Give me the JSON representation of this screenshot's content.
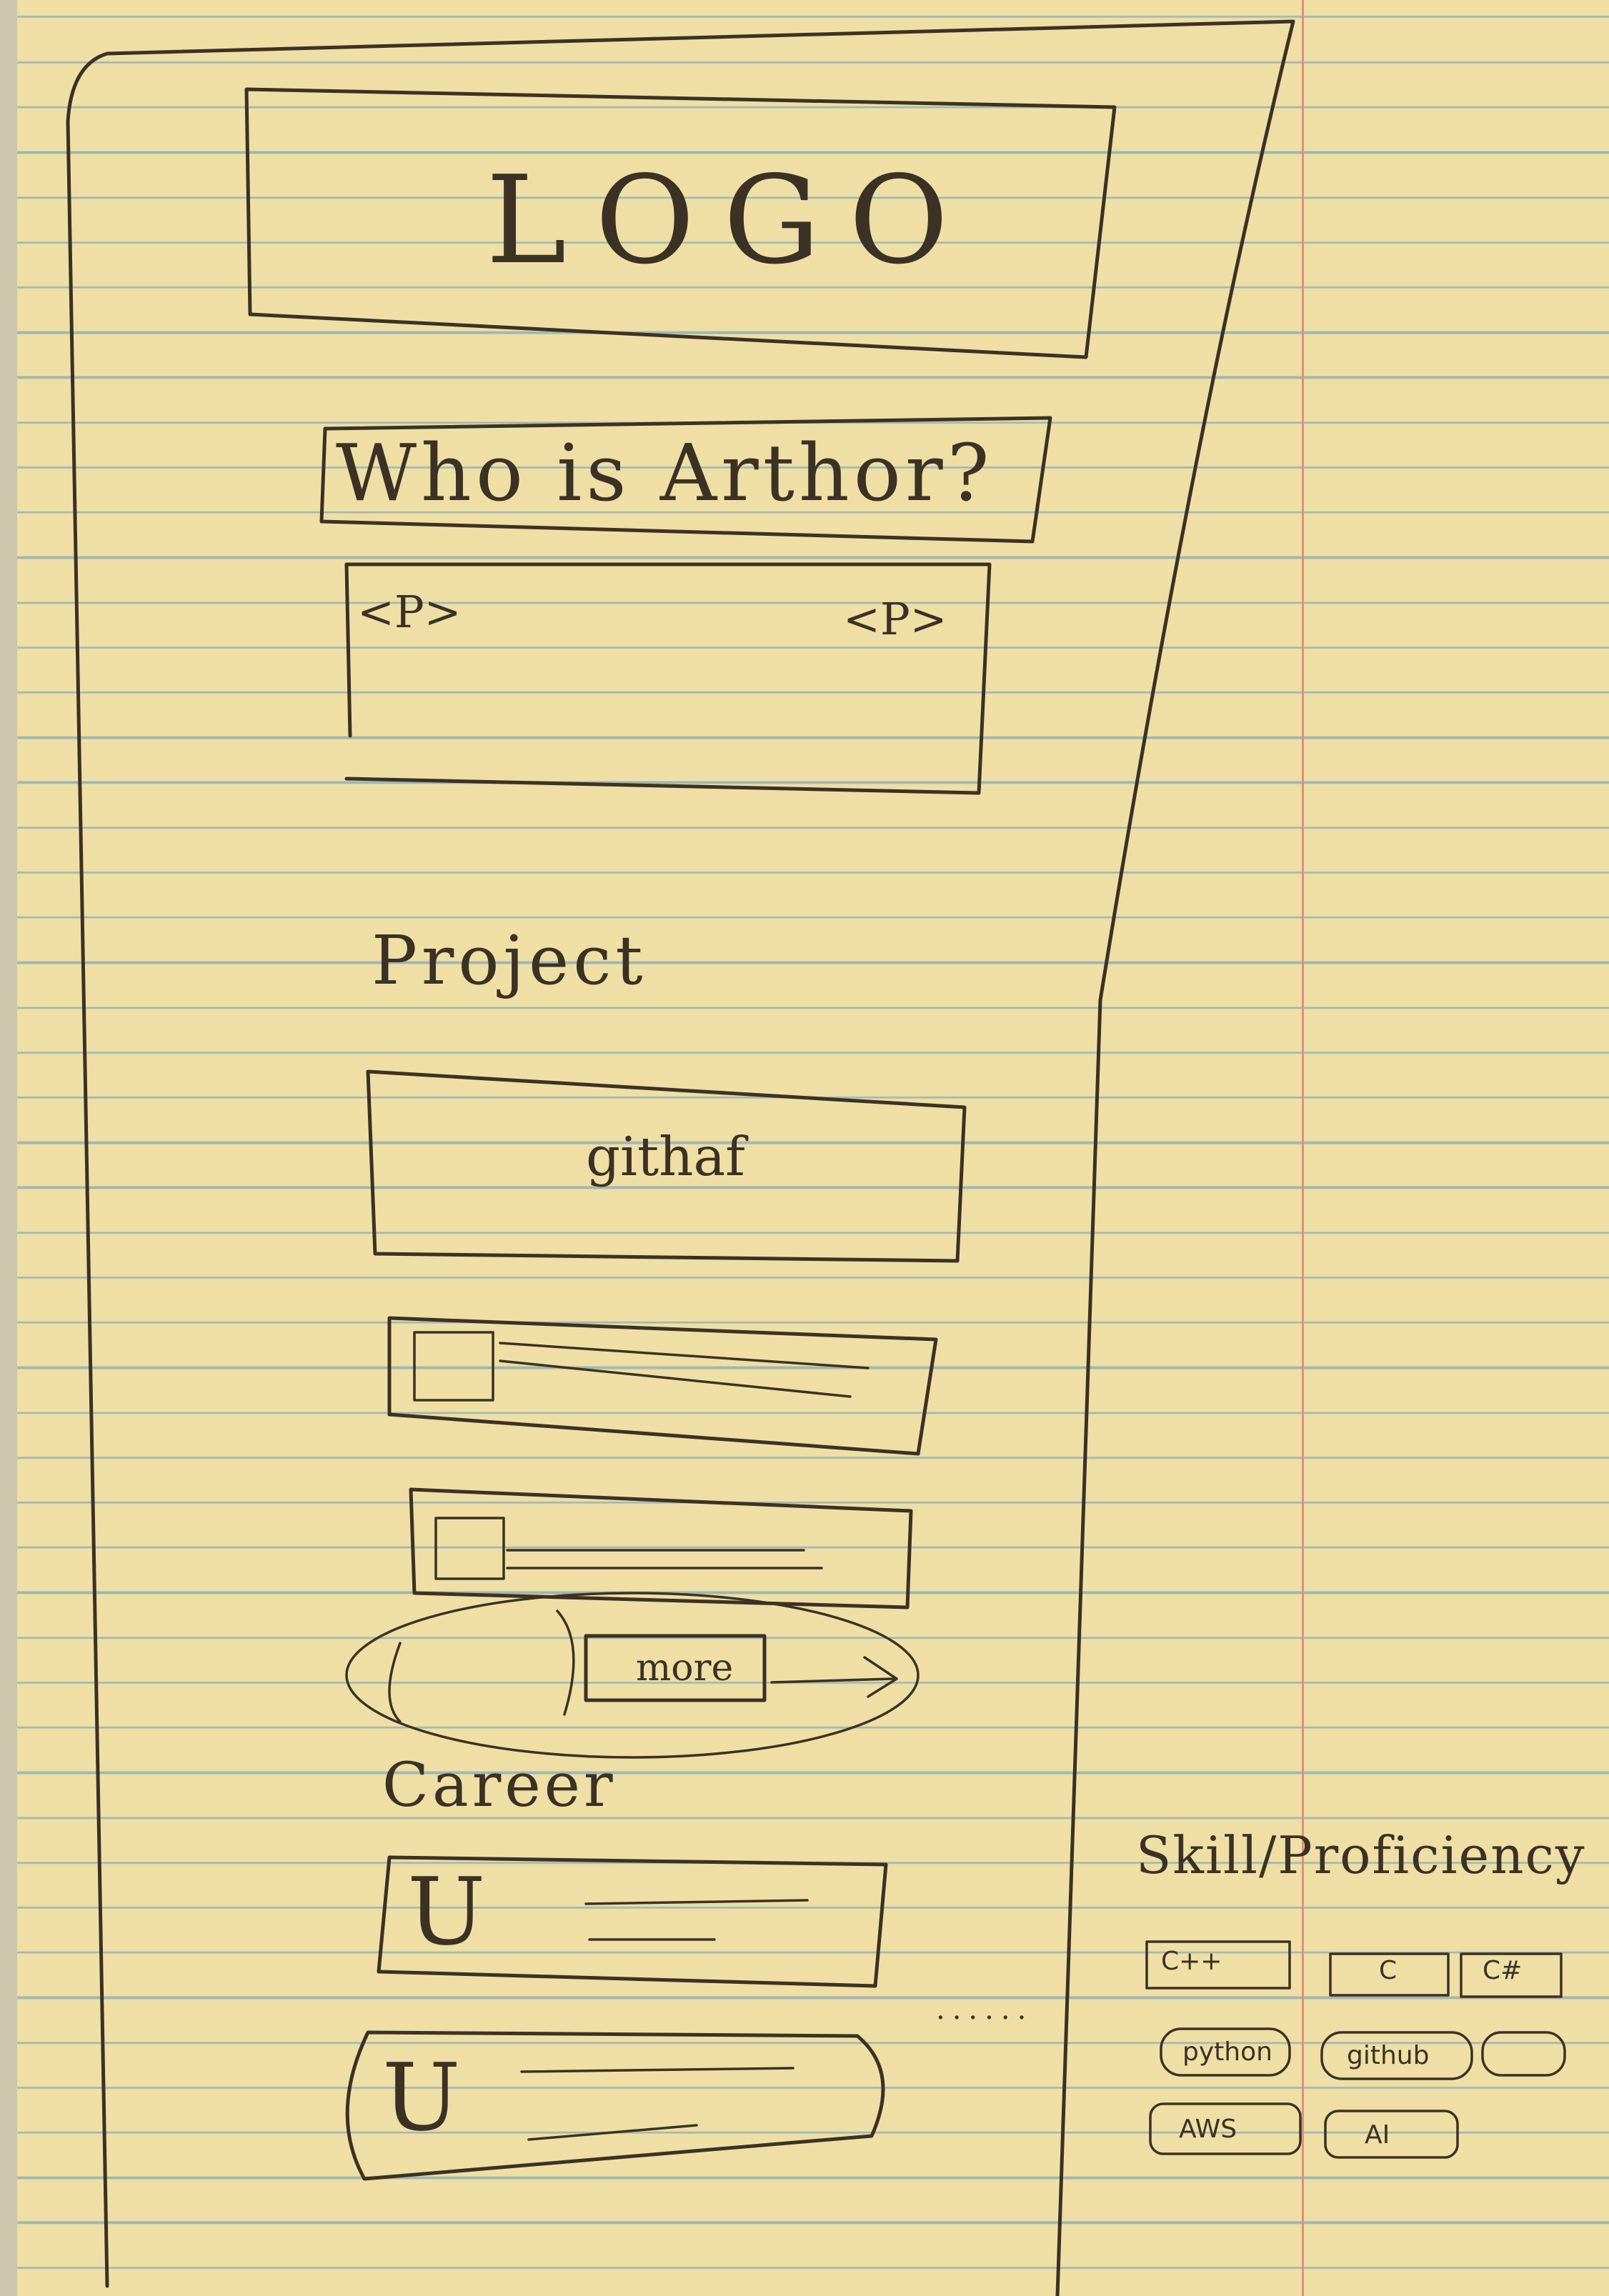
{
  "header": {
    "logo_label": "LOGO"
  },
  "about": {
    "heading": "Who is Arthor?",
    "p_open": "<P>",
    "p_close": "<P>"
  },
  "projects": {
    "heading": "Project",
    "github_label": "githaf",
    "more_label": "more"
  },
  "career": {
    "heading": "Career",
    "entry_icon_1": "U",
    "entry_icon_2": "U"
  },
  "skills": {
    "heading": "Skill/Proficiency",
    "items": [
      "C++",
      "C",
      "C#",
      "python",
      "github",
      "",
      "AWS",
      "AI"
    ]
  },
  "icons": [
    "image-placeholder-icon",
    "arrow-right-icon"
  ]
}
